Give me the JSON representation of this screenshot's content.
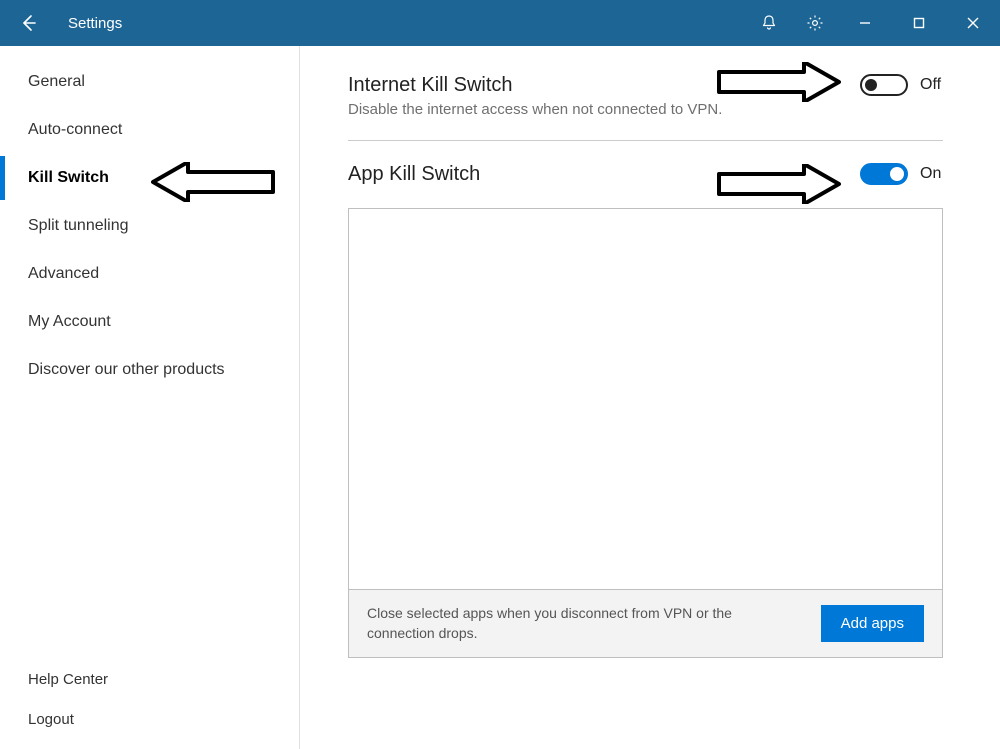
{
  "titlebar": {
    "title": "Settings"
  },
  "sidebar": {
    "items": [
      {
        "label": "General"
      },
      {
        "label": "Auto-connect"
      },
      {
        "label": "Kill Switch"
      },
      {
        "label": "Split tunneling"
      },
      {
        "label": "Advanced"
      },
      {
        "label": "My Account"
      },
      {
        "label": "Discover our other products"
      }
    ],
    "active_index": 2,
    "bottom": [
      {
        "label": "Help Center"
      },
      {
        "label": "Logout"
      }
    ]
  },
  "settings": {
    "internet_kill": {
      "title": "Internet Kill Switch",
      "subtitle": "Disable the internet access when not connected to VPN.",
      "state": "Off",
      "on": false
    },
    "app_kill": {
      "title": "App Kill Switch",
      "state": "On",
      "on": true
    },
    "app_footer": {
      "desc": "Close selected apps when you disconnect from VPN or the connection drops.",
      "button": "Add apps"
    }
  }
}
